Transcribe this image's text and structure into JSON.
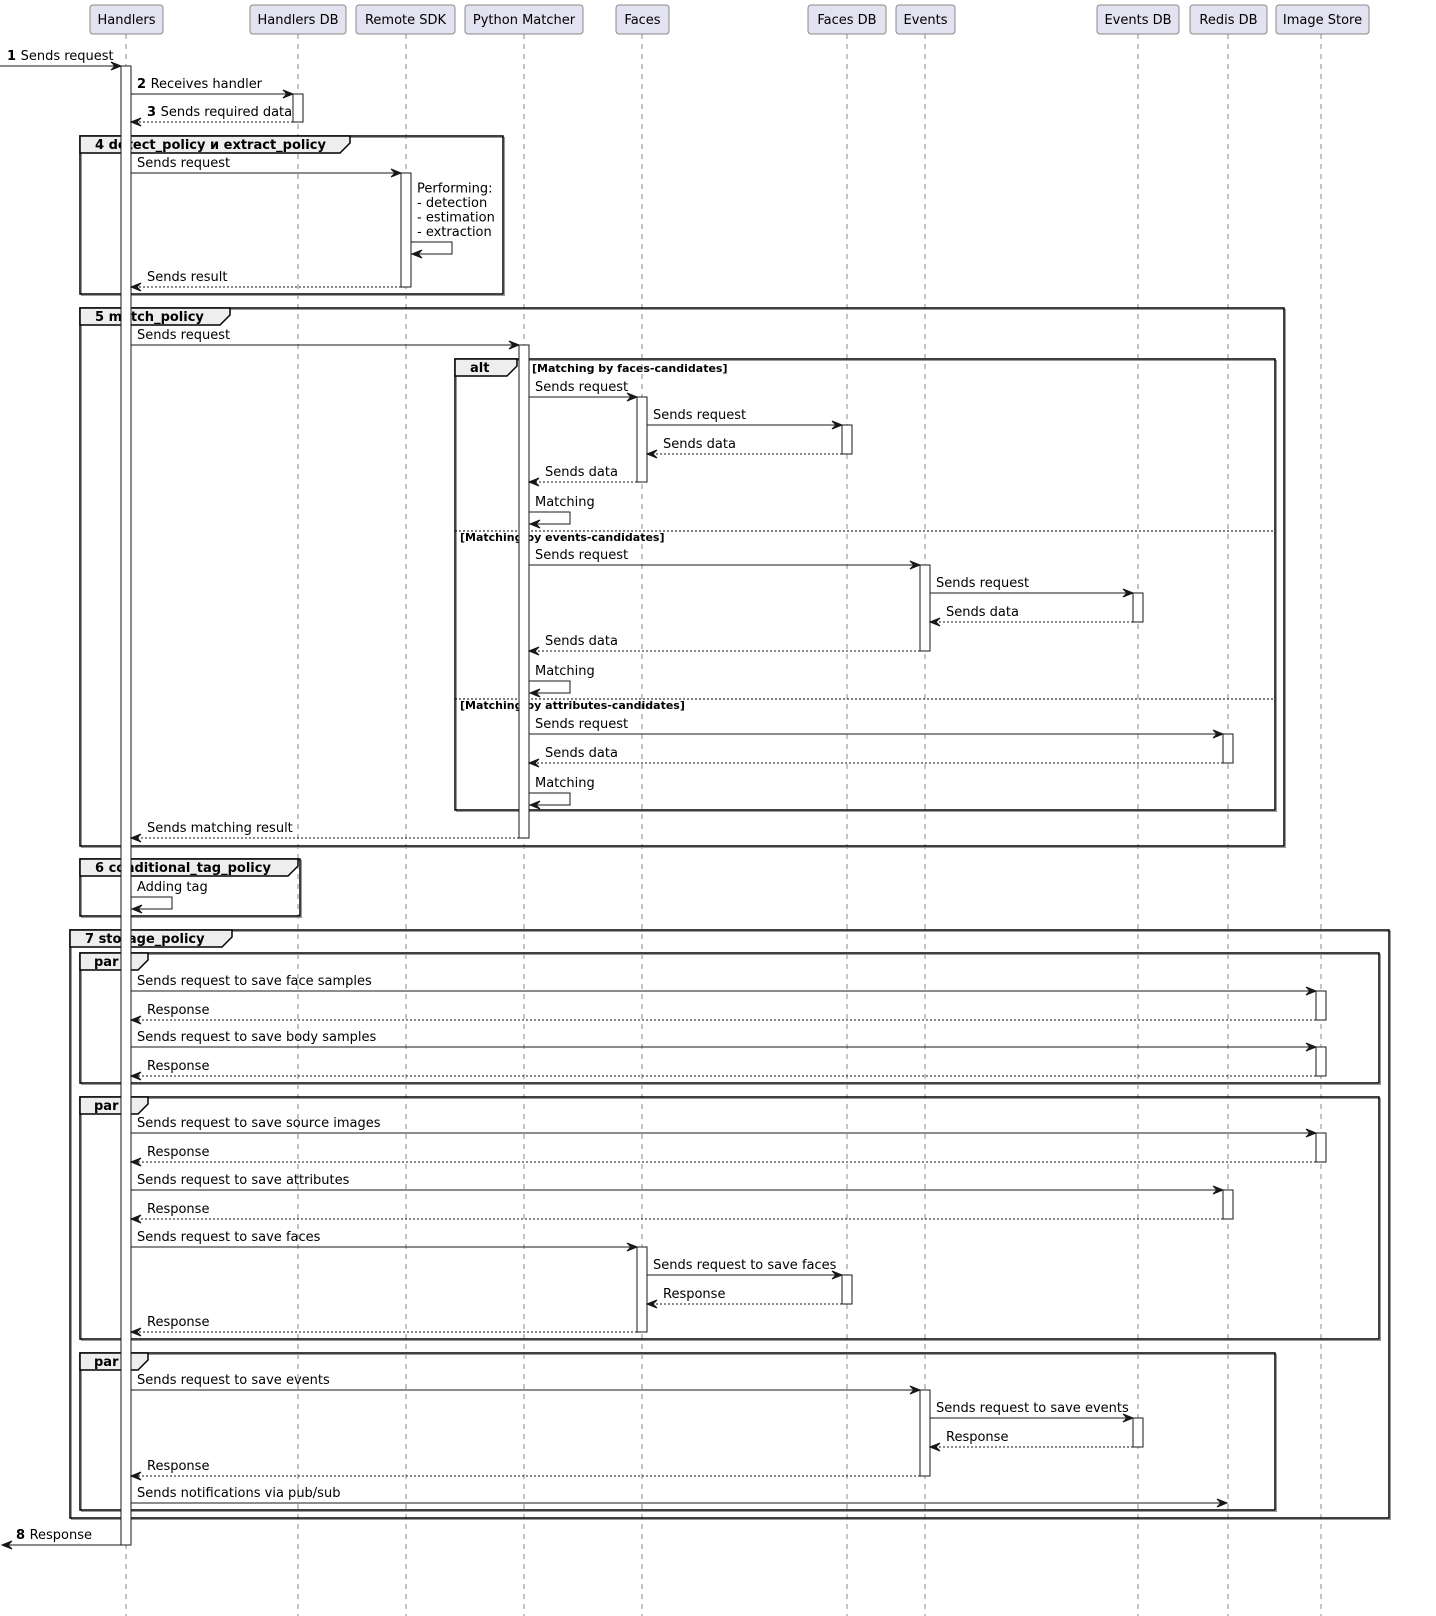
{
  "participants": [
    {
      "id": "handlers",
      "label": "Handlers"
    },
    {
      "id": "handlers_db",
      "label": "Handlers DB"
    },
    {
      "id": "remote_sdk",
      "label": "Remote SDK"
    },
    {
      "id": "python_matcher",
      "label": "Python Matcher"
    },
    {
      "id": "faces",
      "label": "Faces"
    },
    {
      "id": "faces_db",
      "label": "Faces DB"
    },
    {
      "id": "events",
      "label": "Events"
    },
    {
      "id": "events_db",
      "label": "Events DB"
    },
    {
      "id": "redis_db",
      "label": "Redis DB"
    },
    {
      "id": "image_store",
      "label": "Image Store"
    }
  ],
  "messages": [
    {
      "num": "1",
      "text": "Sends request",
      "from": "external_in",
      "to": "handlers",
      "type": "sync"
    },
    {
      "num": "2",
      "text": "Receives handler",
      "from": "handlers",
      "to": "handlers_db",
      "type": "sync"
    },
    {
      "num": "3",
      "text": "Sends required data",
      "from": "handlers_db",
      "to": "handlers",
      "type": "return"
    },
    {
      "num": "",
      "text": "Sends request",
      "from": "handlers",
      "to": "remote_sdk",
      "type": "sync"
    },
    {
      "num": "",
      "text": "Performing:\n- detection\n- estimation\n- extraction",
      "from": "remote_sdk",
      "to": "remote_sdk",
      "type": "self"
    },
    {
      "num": "",
      "text": "Sends result",
      "from": "remote_sdk",
      "to": "handlers",
      "type": "return"
    },
    {
      "num": "",
      "text": "Sends request",
      "from": "handlers",
      "to": "python_matcher",
      "type": "sync"
    },
    {
      "num": "",
      "text": "Sends request",
      "from": "python_matcher",
      "to": "faces",
      "type": "sync"
    },
    {
      "num": "",
      "text": "Sends request",
      "from": "faces",
      "to": "faces_db",
      "type": "sync"
    },
    {
      "num": "",
      "text": "Sends data",
      "from": "faces_db",
      "to": "faces",
      "type": "return"
    },
    {
      "num": "",
      "text": "Sends data",
      "from": "faces",
      "to": "python_matcher",
      "type": "return"
    },
    {
      "num": "",
      "text": "Matching",
      "from": "python_matcher",
      "to": "python_matcher",
      "type": "self"
    },
    {
      "num": "",
      "text": "Sends request",
      "from": "python_matcher",
      "to": "events",
      "type": "sync"
    },
    {
      "num": "",
      "text": "Sends request",
      "from": "events",
      "to": "events_db",
      "type": "sync"
    },
    {
      "num": "",
      "text": "Sends data",
      "from": "events_db",
      "to": "events",
      "type": "return"
    },
    {
      "num": "",
      "text": "Sends data",
      "from": "events",
      "to": "python_matcher",
      "type": "return"
    },
    {
      "num": "",
      "text": "Matching",
      "from": "python_matcher",
      "to": "python_matcher",
      "type": "self"
    },
    {
      "num": "",
      "text": "Sends request",
      "from": "python_matcher",
      "to": "redis_db",
      "type": "sync"
    },
    {
      "num": "",
      "text": "Sends data",
      "from": "redis_db",
      "to": "python_matcher",
      "type": "return"
    },
    {
      "num": "",
      "text": "Matching",
      "from": "python_matcher",
      "to": "python_matcher",
      "type": "self"
    },
    {
      "num": "",
      "text": "Sends matching result",
      "from": "python_matcher",
      "to": "handlers",
      "type": "return"
    },
    {
      "num": "",
      "text": "Adding tag",
      "from": "handlers",
      "to": "handlers",
      "type": "self"
    },
    {
      "num": "",
      "text": "Sends request to save face samples",
      "from": "handlers",
      "to": "image_store",
      "type": "sync"
    },
    {
      "num": "",
      "text": "Response",
      "from": "image_store",
      "to": "handlers",
      "type": "return"
    },
    {
      "num": "",
      "text": "Sends request to save body samples",
      "from": "handlers",
      "to": "image_store",
      "type": "sync"
    },
    {
      "num": "",
      "text": "Response",
      "from": "image_store",
      "to": "handlers",
      "type": "return"
    },
    {
      "num": "",
      "text": "Sends request to save source images",
      "from": "handlers",
      "to": "image_store",
      "type": "sync"
    },
    {
      "num": "",
      "text": "Response",
      "from": "image_store",
      "to": "handlers",
      "type": "return"
    },
    {
      "num": "",
      "text": "Sends request to save attributes",
      "from": "handlers",
      "to": "redis_db",
      "type": "sync"
    },
    {
      "num": "",
      "text": "Response",
      "from": "redis_db",
      "to": "handlers",
      "type": "return"
    },
    {
      "num": "",
      "text": "Sends request to save faces",
      "from": "handlers",
      "to": "faces",
      "type": "sync"
    },
    {
      "num": "",
      "text": "Sends request to save faces",
      "from": "faces",
      "to": "faces_db",
      "type": "sync"
    },
    {
      "num": "",
      "text": "Response",
      "from": "faces_db",
      "to": "faces",
      "type": "return"
    },
    {
      "num": "",
      "text": "Response",
      "from": "faces",
      "to": "handlers",
      "type": "return"
    },
    {
      "num": "",
      "text": "Sends request to save events",
      "from": "handlers",
      "to": "events",
      "type": "sync"
    },
    {
      "num": "",
      "text": "Sends request to save events",
      "from": "events",
      "to": "events_db",
      "type": "sync"
    },
    {
      "num": "",
      "text": "Response",
      "from": "events_db",
      "to": "events",
      "type": "return"
    },
    {
      "num": "",
      "text": "Response",
      "from": "events",
      "to": "handlers",
      "type": "return"
    },
    {
      "num": "",
      "text": "Sends notifications via pub/sub",
      "from": "handlers",
      "to": "redis_db",
      "type": "async"
    },
    {
      "num": "8",
      "text": "Response",
      "from": "handlers",
      "to": "external_out",
      "type": "sync"
    }
  ],
  "fragments": [
    {
      "kind": "group",
      "title": "4 detect_policy и extract_policy"
    },
    {
      "kind": "group",
      "title": "5 match_policy"
    },
    {
      "kind": "alt",
      "title": "alt",
      "guards": [
        "[Matching by faces-candidates]",
        "[Matching by events-candidates]",
        "[Matching by attributes-candidates]"
      ]
    },
    {
      "kind": "group",
      "title": "6 conditional_tag_policy"
    },
    {
      "kind": "group",
      "title": "7 storage_policy"
    },
    {
      "kind": "par",
      "title": "par"
    },
    {
      "kind": "par",
      "title": "par"
    },
    {
      "kind": "par",
      "title": "par"
    }
  ],
  "colors": {
    "participant_fill": "#e2e2f0",
    "participant_border": "#888888",
    "line": "#181818",
    "frame_tab_fill": "#eeeeee"
  }
}
